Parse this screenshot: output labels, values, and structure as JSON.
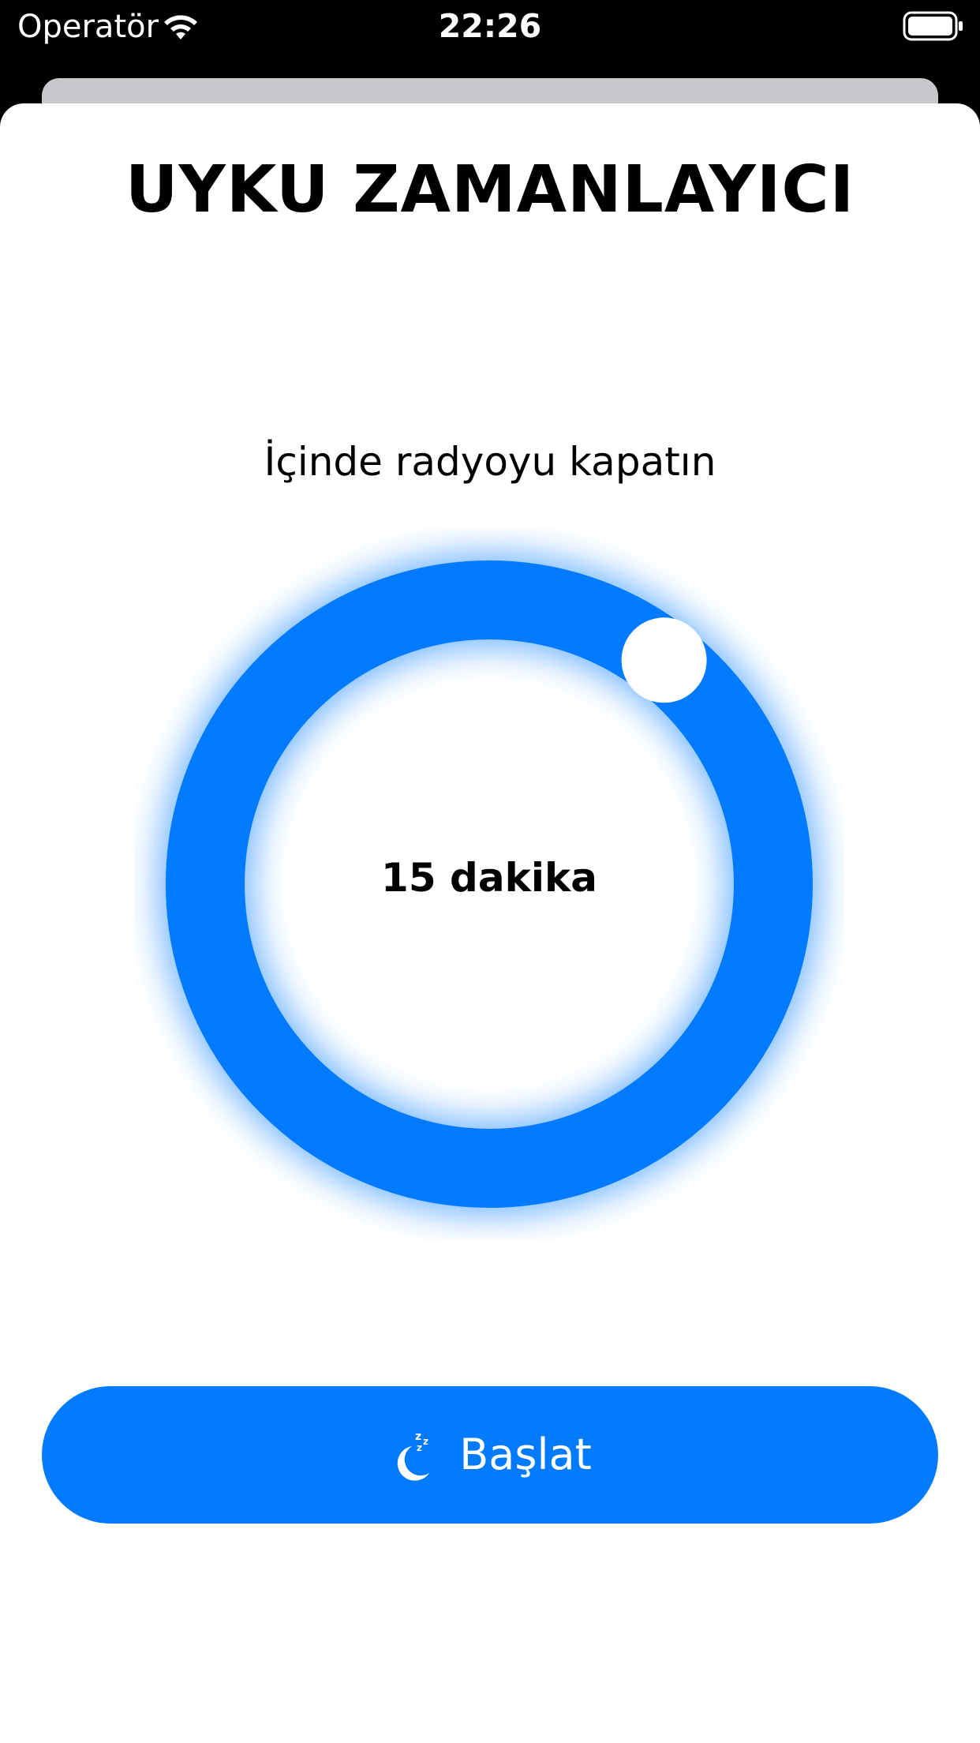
{
  "status_bar": {
    "carrier": "Operatör",
    "time": "22:26",
    "icons": [
      "wifi-icon",
      "battery-icon"
    ]
  },
  "screen": {
    "title": "UYKU ZAMANLAYICI",
    "subtitle": "İçinde radyoyu kapatın"
  },
  "timer": {
    "value_label": "15 dakika",
    "minutes": 15,
    "knob_angle_deg": 38
  },
  "start_button": {
    "label": "Başlat",
    "icon": "sleep-moon-icon"
  },
  "colors": {
    "accent": "#007aff",
    "background": "#ffffff",
    "status_bar": "#000000"
  }
}
